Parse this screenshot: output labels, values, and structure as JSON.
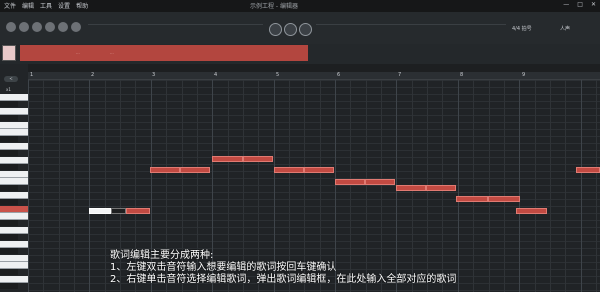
{
  "window": {
    "menu": [
      "文件",
      "编辑",
      "工具",
      "设置",
      "帮助"
    ],
    "title": "示例工程 - 编辑器",
    "controls": [
      "—",
      "□",
      "✕"
    ]
  },
  "toolbar": {
    "tempo_select": "4/4 拍号",
    "mode_select": "人声"
  },
  "track": {
    "thumbnail_left": "...",
    "thumbnail_mid": "..."
  },
  "piano_roll": {
    "zoom_button": "<",
    "zoom_label": "x1",
    "measures": [
      "1",
      "2",
      "3",
      "4",
      "5",
      "6",
      "7",
      "8",
      "9"
    ],
    "notes": [
      {
        "label": "",
        "style": "white"
      },
      {
        "label": "",
        "style": "dark"
      },
      {
        "label": "",
        "style": "red"
      },
      {
        "label": "",
        "style": "red"
      },
      {
        "label": "",
        "style": "red"
      },
      {
        "label": "",
        "style": "red"
      },
      {
        "label": "",
        "style": "red"
      },
      {
        "label": "",
        "style": "red"
      },
      {
        "label": "",
        "style": "red"
      },
      {
        "label": "",
        "style": "red"
      },
      {
        "label": "",
        "style": "red"
      },
      {
        "label": "",
        "style": "red"
      },
      {
        "label": "",
        "style": "red"
      },
      {
        "label": "",
        "style": "red"
      },
      {
        "label": "",
        "style": "red"
      },
      {
        "label": "",
        "style": "red"
      },
      {
        "label": "",
        "style": "red"
      }
    ]
  },
  "caption": {
    "line1": "歌词编辑主要分成两种:",
    "line2": "1、左键双击音符输入想要编辑的歌词按回车键确认",
    "line3": "2、右键单击音符选择编辑歌词，弹出歌词编辑框，在此处输入全部对应的歌词"
  },
  "colors": {
    "note_fill": "#c24a42",
    "background": "#202326",
    "accent": "#b3463f"
  }
}
